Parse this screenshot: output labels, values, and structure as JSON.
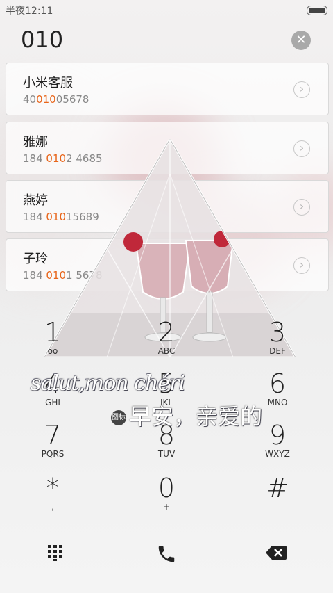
{
  "status_bar": {
    "time": "半夜12:11"
  },
  "dialer": {
    "number": "010"
  },
  "contacts": [
    {
      "name": "小米客服",
      "num_pre": "40",
      "num_hl": "010",
      "num_post": "05678"
    },
    {
      "name": "雅娜",
      "num_pre": "184 ",
      "num_hl": "010",
      "num_post": "2 4685"
    },
    {
      "name": "燕婷",
      "num_pre": "184 ",
      "num_hl": "010",
      "num_post": "15689"
    },
    {
      "name": "子玲",
      "num_pre": "184 ",
      "num_hl": "010",
      "num_post": "1 5678"
    }
  ],
  "keypad": [
    {
      "digit": "1",
      "letters": "oo"
    },
    {
      "digit": "2",
      "letters": "ABC"
    },
    {
      "digit": "3",
      "letters": "DEF"
    },
    {
      "digit": "4",
      "letters": "GHI"
    },
    {
      "digit": "5",
      "letters": "JKL"
    },
    {
      "digit": "6",
      "letters": "MNO"
    },
    {
      "digit": "7",
      "letters": "PQRS"
    },
    {
      "digit": "8",
      "letters": "TUV"
    },
    {
      "digit": "9",
      "letters": "WXYZ"
    },
    {
      "digit": "*",
      "letters": ","
    },
    {
      "digit": "0",
      "letters": "+"
    },
    {
      "digit": "#",
      "letters": ""
    }
  ],
  "stickers": {
    "line1": "salut,mon chéri",
    "line2": "早安，亲爱的",
    "badge": "图标"
  },
  "icons": {
    "keypad_toggle": "dialpad-icon",
    "call": "phone-icon",
    "backspace": "backspace-icon",
    "clear": "clear-icon"
  },
  "colors": {
    "highlight": "#e8651a"
  }
}
